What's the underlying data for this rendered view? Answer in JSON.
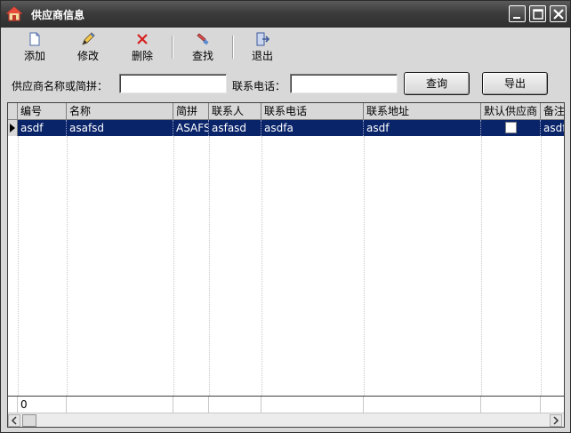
{
  "window": {
    "title": "供应商信息",
    "icons": [
      "home-icon",
      "minimize-icon",
      "maximize-icon",
      "close-icon"
    ]
  },
  "toolbar": {
    "items": [
      {
        "label": "添加",
        "icon": "new-document-icon"
      },
      {
        "label": "修改",
        "icon": "pencil-icon"
      },
      {
        "label": "删除",
        "icon": "delete-x-icon"
      },
      {
        "label": "查找",
        "icon": "find-icon"
      },
      {
        "label": "退出",
        "icon": "exit-door-icon"
      }
    ]
  },
  "search": {
    "name_label": "供应商名称或简拼：",
    "name_value": "",
    "phone_label": "联系电话：",
    "phone_value": "",
    "query_button": "查询",
    "export_button": "导出"
  },
  "grid": {
    "columns": [
      "编号",
      "名称",
      "简拼",
      "联系人",
      "联系电话",
      "联系地址",
      "默认供应商",
      "备注"
    ],
    "rows": [
      {
        "编号": "asdf",
        "名称": "asafsd",
        "简拼": "ASAFSD",
        "联系人": "asfasd",
        "联系电话": "asdfa",
        "联系地址": "asdf",
        "默认供应商": false,
        "备注": "asdfa"
      }
    ],
    "footer_count": "0",
    "selection_color": "#0a246a"
  }
}
